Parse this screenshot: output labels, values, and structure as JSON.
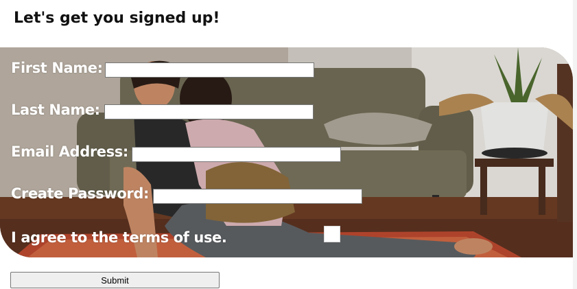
{
  "header": {
    "title": "Let's get you signed up!"
  },
  "form": {
    "first_name": {
      "label": "First Name:",
      "value": ""
    },
    "last_name": {
      "label": "Last Name:",
      "value": ""
    },
    "email": {
      "label": "Email Address:",
      "value": ""
    },
    "password": {
      "label": "Create Password:",
      "value": ""
    },
    "terms": {
      "label": "I agree to the terms of use.",
      "checked": false
    },
    "submit_label": "Submit"
  },
  "colors": {
    "label_text": "#ffffff",
    "title_text": "#111111",
    "button_bg": "#efefef"
  }
}
